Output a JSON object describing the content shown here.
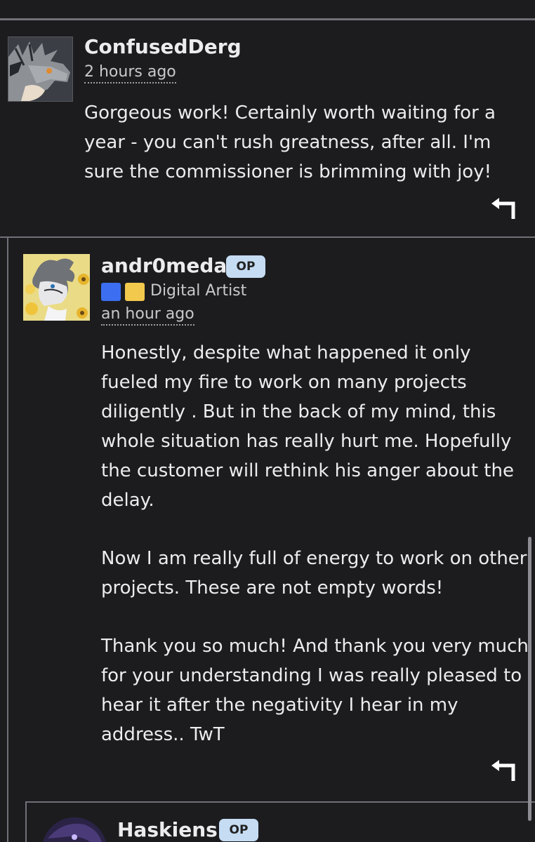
{
  "comments": [
    {
      "author": "ConfusedDerg",
      "time": "2 hours ago",
      "body": "Gorgeous work! Certainly worth waiting for a year - you can't rush greatness, after all. I'm sure the commissioner is brimming with joy!"
    },
    {
      "author": "andr0meda",
      "badge": "OP",
      "role": "Digital Artist",
      "time": "an hour ago",
      "paragraphs": [
        "Honestly, despite what happened it only fueled my fire to work on many projects diligently . But in the back of my mind, this whole situation has really hurt me. Hopefully the customer will rethink his anger about the delay.",
        "Now I am really full of energy to work on other projects. These are not empty words!",
        "Thank you so much! And thank you very much for your understanding I was really pleased to hear it after the negativity I hear in my address.. TwT"
      ]
    },
    {
      "author": "Haskiens",
      "badge": "OP"
    }
  ],
  "colors": {
    "background": "#1c1c1f",
    "divider": "#707078",
    "op_badge": "#c5dcf3",
    "badge_blue": "#3b6ef0",
    "badge_yellow": "#f2c94c"
  },
  "icons": {
    "reply": "reply-arrow-icon"
  }
}
